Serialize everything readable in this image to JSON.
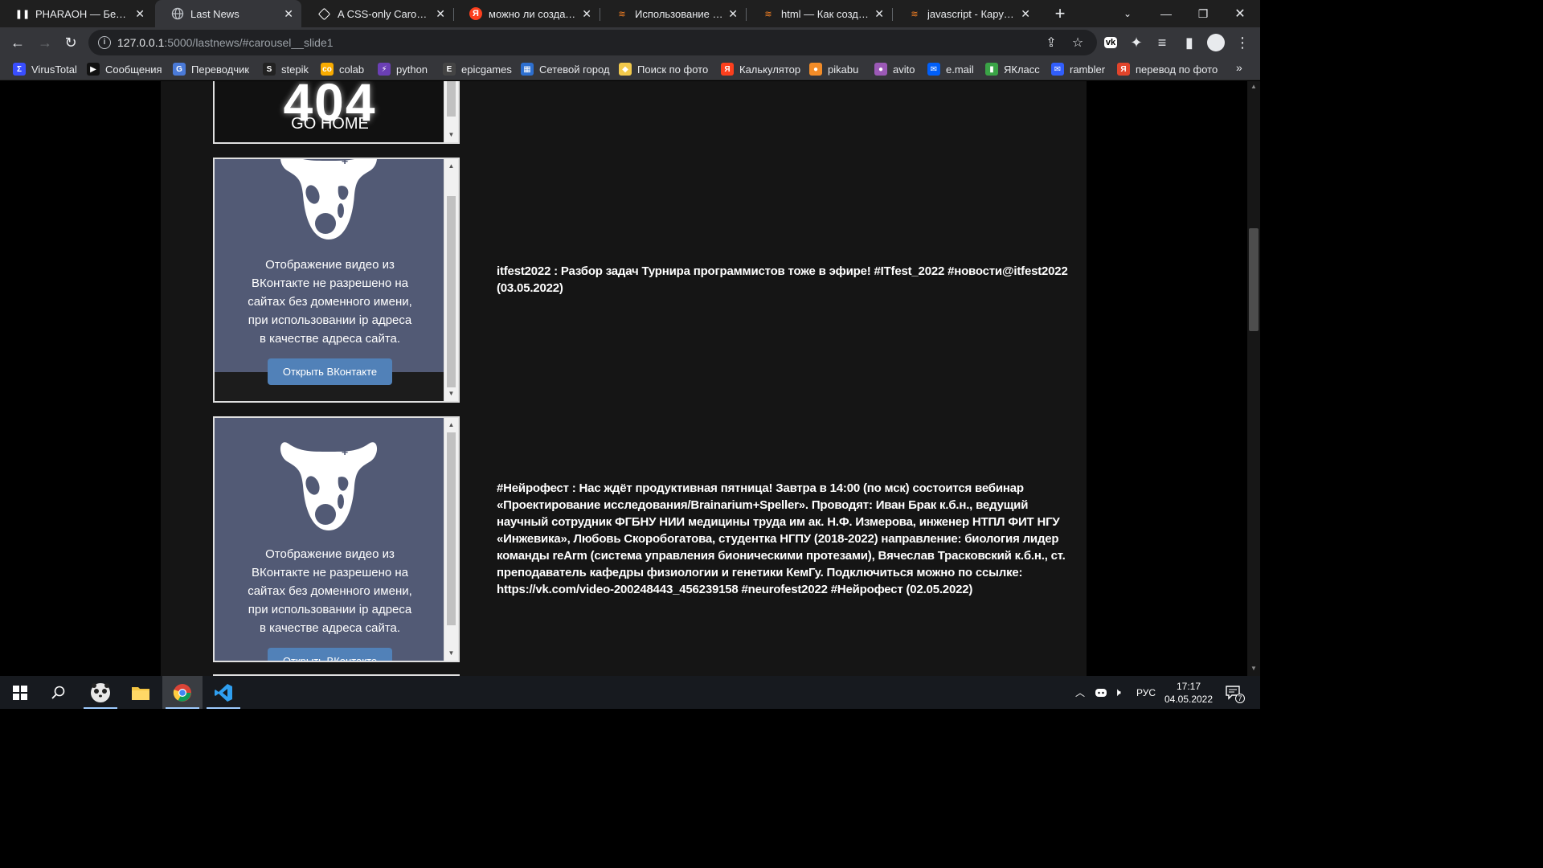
{
  "tabs": [
    {
      "title": "PHARAOH — Без клю",
      "icon": "pause-icon",
      "active": false
    },
    {
      "title": "Last News",
      "icon": "globe-icon",
      "active": true
    },
    {
      "title": "A CSS-only Carousel S",
      "icon": "codepen-icon",
      "active": false
    },
    {
      "title": "можно ли создать ка",
      "icon": "yandex-icon",
      "active": false
    },
    {
      "title": "Использование Pyth",
      "icon": "stackoverflow-icon",
      "active": false
    },
    {
      "title": "html — Как создать д",
      "icon": "stackoverflow-icon",
      "active": false
    },
    {
      "title": "javascript - Карусель",
      "icon": "stackoverflow-icon",
      "active": false
    }
  ],
  "address": {
    "host": "127.0.0.1",
    "path": ":5000/lastnews/#carousel__slide1"
  },
  "bookmarks": [
    {
      "label": "VirusTotal",
      "icon": "virustotal-icon",
      "color": "#394eff"
    },
    {
      "label": "Сообщения",
      "icon": "play-icon",
      "color": "#111111"
    },
    {
      "label": "Переводчик",
      "icon": "translate-icon",
      "color": "#4a7ad8"
    },
    {
      "label": "stepik",
      "icon": "stepik-icon",
      "color": "#222222"
    },
    {
      "label": "colab",
      "icon": "colab-icon",
      "color": "#f9ab00"
    },
    {
      "label": "python",
      "icon": "bolt-icon",
      "color": "#6b3fb5"
    },
    {
      "label": "epicgames",
      "icon": "epic-icon",
      "color": "#444444"
    },
    {
      "label": "Сетевой город",
      "icon": "grid-icon",
      "color": "#2d6fcf"
    },
    {
      "label": "Поиск по фото",
      "icon": "image-search-icon",
      "color": "#f2c94c"
    },
    {
      "label": "Калькулятор",
      "icon": "yandex-icon",
      "color": "#fc3f1d"
    },
    {
      "label": "pikabu",
      "icon": "pikabu-icon",
      "color": "#f28c28"
    },
    {
      "label": "avito",
      "icon": "avito-icon",
      "color": "#9b59b6"
    },
    {
      "label": "e.mail",
      "icon": "mail-icon",
      "color": "#005ff9"
    },
    {
      "label": "ЯКласс",
      "icon": "yaklass-icon",
      "color": "#3aa346"
    },
    {
      "label": "rambler",
      "icon": "rambler-icon",
      "color": "#315efb"
    },
    {
      "label": "перевод по фото",
      "icon": "yandex-translate-icon",
      "color": "#e0442b"
    }
  ],
  "top_frame": {
    "big_text": "404",
    "link_text": "GO HOME"
  },
  "video_message": {
    "lines": [
      "Отображение видео из",
      "ВКонтакте не разрешено на",
      "сайтах без доменного имени,",
      "при использовании ip адреса",
      "в качестве адреса сайта."
    ],
    "button": "Открыть ВКонтакте"
  },
  "news": [
    {
      "text": "itfest2022 : Разбор задач Турнира программистов тоже в эфире! #ITfest_2022 #новости@itfest2022 (03.05.2022)"
    },
    {
      "text": "#Нейрофест : Нас ждёт продуктивная пятница! Завтра в 14:00 (по мск) состоится вебинар «Проектирование исследования/Brainarium+Speller». Проводят: Иван Брак к.б.н., ведущий научный сотрудник ФГБНУ НИИ медицины труда им ак. Н.Ф. Измерова, инженер НТПЛ ФИТ НГУ «Инжевика», Любовь Скоробогатова, студентка НГПУ (2018-2022) направление: биология лидер команды reArm (система управления бионическими протезами), Вячеслав Трасковский к.б.н., ст. преподаватель кафедры физиологии и генетики КемГу. Подключиться можно по ссылке: https://vk.com/video-200248443_456239158 #neurofest2022 #Нейрофест (02.05.2022)"
    }
  ],
  "taskbar": {
    "apps": [
      "windows-start-icon",
      "search-icon",
      "panda-app-icon",
      "file-explorer-icon",
      "chrome-icon",
      "vscode-icon"
    ],
    "language": "РУС",
    "time": "17:17",
    "date": "04.05.2022",
    "notifications": "7"
  }
}
